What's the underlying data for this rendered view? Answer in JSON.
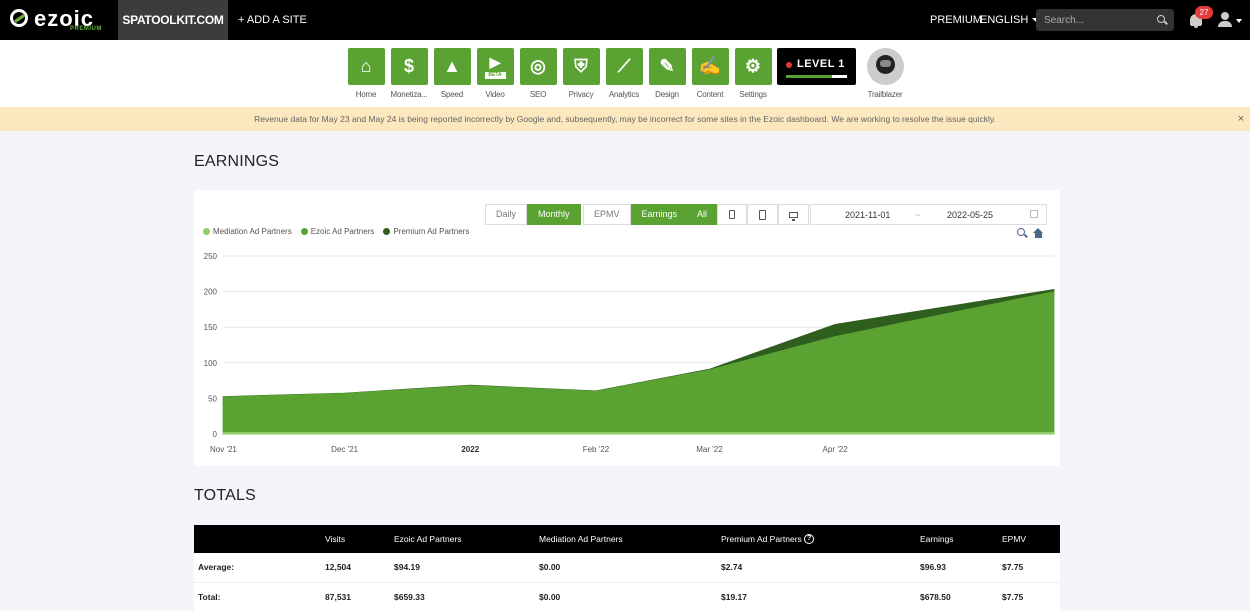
{
  "topbar": {
    "logo_text": "ezoic",
    "logo_sub": "PREMIUM",
    "site": "SPATOOLKIT.COM",
    "add_site": "+ ADD A SITE",
    "premium": "PREMIUM",
    "language": "ENGLISH",
    "search_placeholder": "Search...",
    "notifications": "27"
  },
  "nav": [
    {
      "label": "Home",
      "icon": "home-icon",
      "glyph": "⌂"
    },
    {
      "label": "Monetiza...",
      "icon": "dollar-icon",
      "glyph": "$"
    },
    {
      "label": "Speed",
      "icon": "rocket-icon",
      "glyph": "▲"
    },
    {
      "label": "Video",
      "icon": "video-icon",
      "glyph": "▶",
      "badge": "BETA"
    },
    {
      "label": "SEO",
      "icon": "magnifier-icon",
      "glyph": "◎"
    },
    {
      "label": "Privacy",
      "icon": "shield-icon",
      "glyph": "⛨"
    },
    {
      "label": "Analytics",
      "icon": "line-chart-icon",
      "glyph": "⟋"
    },
    {
      "label": "Design",
      "icon": "design-icon",
      "glyph": "✎"
    },
    {
      "label": "Content",
      "icon": "content-icon",
      "glyph": "✍"
    },
    {
      "label": "Settings",
      "icon": "gear-icon",
      "glyph": "⚙"
    }
  ],
  "level": {
    "text": "LEVEL 1",
    "progress": 0.75
  },
  "trailblazer": {
    "label": "Trailblazer"
  },
  "notice": {
    "text": "Revenue data for May 23 and May 24 is being reported incorrectly by Google and, subsequently, may be incorrect for some sites in the Ezoic dashboard. We are working to resolve the issue quickly.",
    "close": "×"
  },
  "earnings": {
    "title": "EARNINGS",
    "period_buttons": [
      "Daily",
      "Monthly"
    ],
    "metric_buttons": [
      "EPMV",
      "Earnings"
    ],
    "device_all": "All",
    "date_from": "2021-11-01",
    "date_sep": "~",
    "date_to": "2022-05-25"
  },
  "chart_data": {
    "type": "area",
    "title": "",
    "xlabel": "",
    "ylabel": "",
    "ylim": [
      0,
      250
    ],
    "y_ticks": [
      "0",
      "50",
      "100",
      "150",
      "200",
      "250"
    ],
    "x_ticks": [
      {
        "label": "Nov '21",
        "bold": false
      },
      {
        "label": "Dec '21",
        "bold": false
      },
      {
        "label": "2022",
        "bold": true
      },
      {
        "label": "Feb '22",
        "bold": false
      },
      {
        "label": "Mar '22",
        "bold": false
      },
      {
        "label": "Apr '22",
        "bold": false
      }
    ],
    "x": [
      "2021-11-01",
      "2021-12-01",
      "2022-01-01",
      "2022-02-01",
      "2022-03-01",
      "2022-04-01",
      "2022-05-25"
    ],
    "legend_position": "top-left",
    "series": [
      {
        "name": "Mediation Ad Partners",
        "color": "#8fcf6a",
        "values": [
          0,
          0,
          0,
          0,
          0,
          0,
          0
        ]
      },
      {
        "name": "Ezoic Ad Partners",
        "color": "#5aa332",
        "values": [
          52,
          57,
          68,
          60,
          90,
          137,
          200
        ]
      },
      {
        "name": "Premium Ad Partners",
        "color": "#2f5e1e",
        "values": [
          0.5,
          0.5,
          0.5,
          0.5,
          1,
          17,
          3
        ]
      }
    ],
    "grid": true
  },
  "totals": {
    "title": "TOTALS",
    "headers": [
      "",
      "Visits",
      "Ezoic Ad Partners",
      "Mediation Ad Partners",
      "Premium Ad Partners",
      "Earnings",
      "EPMV"
    ],
    "rows": [
      [
        "Average:",
        "12,504",
        "$94.19",
        "$0.00",
        "$2.74",
        "$96.93",
        "$7.75"
      ],
      [
        "Total:",
        "87,531",
        "$659.33",
        "$0.00",
        "$19.17",
        "$678.50",
        "$7.75"
      ]
    ]
  }
}
